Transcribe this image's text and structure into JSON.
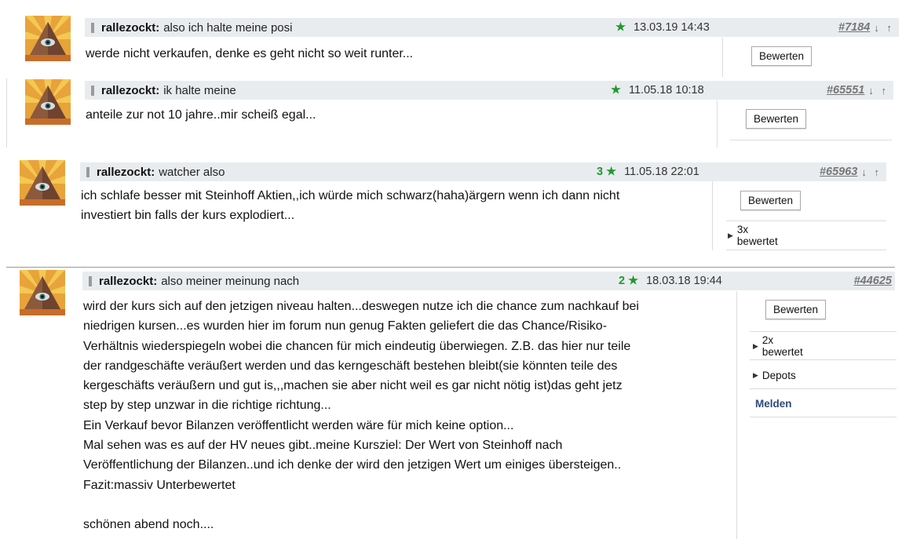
{
  "posts": [
    {
      "author": "rallezockt:",
      "subject": "also ich halte meine posi",
      "stars": "★",
      "date": "13.03.19 14:43",
      "postno": "#7184",
      "arrows": "↓ ↑",
      "body": [
        "werde nicht verkaufen, denke es geht nicht so weit runter..."
      ],
      "rate_label": "Bewerten"
    },
    {
      "author": "rallezockt:",
      "subject": "ik halte meine",
      "stars": "★",
      "date": "11.05.18 10:18",
      "postno": "#65551",
      "arrows": "↓ ↑",
      "body": [
        "anteile zur not 10 jahre..mir scheiß egal..."
      ],
      "rate_label": "Bewerten"
    },
    {
      "author": "rallezockt:",
      "subject": "watcher also",
      "stars": "3 ★",
      "date": "11.05.18 22:01",
      "postno": "#65963",
      "arrows": "↓ ↑",
      "body": [
        "ich schlafe besser mit Steinhoff Aktien,,ich würde mich schwarz(haha)ärgern wenn ich dann nicht",
        "investiert bin falls der kurs explodiert..."
      ],
      "rate_label": "Bewerten",
      "rated": "3x bewertet"
    },
    {
      "author": "rallezockt:",
      "subject": "also meiner meinung nach",
      "stars": "2 ★",
      "date": "18.03.18 19:44",
      "postno": "#44625",
      "body": [
        "wird der kurs sich auf den jetzigen niveau halten...deswegen nutze ich die chance zum nachkauf bei",
        "niedrigen kursen...es wurden hier im forum nun genug Fakten geliefert die das Chance/Risiko-",
        "Verhältnis wiederspiegeln wobei die chancen für mich eindeutig überwiegen. Z.B. das hier nur teile",
        "der randgeschäfte veräußert werden und das kerngeschäft bestehen bleibt(sie könnten teile des",
        "kergeschäfts veräußern und gut is,,,machen sie aber nicht weil es gar nicht nötig ist)das geht jetz",
        "step by step unzwar in die richtige richtung...",
        "Ein Verkauf bevor Bilanzen veröffentlicht werden wäre für mich keine option...",
        "Mal sehen was es auf der HV neues gibt..meine Kursziel: Der Wert von Steinhoff nach",
        "Veröffentlichung der Bilanzen..und ich denke der wird den jetzigen Wert um einiges übersteigen..",
        "Fazit:massiv Unterbewertet",
        "",
        "schönen abend noch...."
      ],
      "rate_label": "Bewerten",
      "rated": "2x bewertet",
      "depots": "Depots",
      "report": "Melden"
    }
  ],
  "colors": {
    "header_bg": "#e9ecef",
    "star_green": "#1e9a2e",
    "report_blue": "#2d4a7a"
  },
  "icons": {
    "avatar": "pyramid-eye-avatar",
    "expand": "triangle-right-icon",
    "star": "star-icon"
  }
}
